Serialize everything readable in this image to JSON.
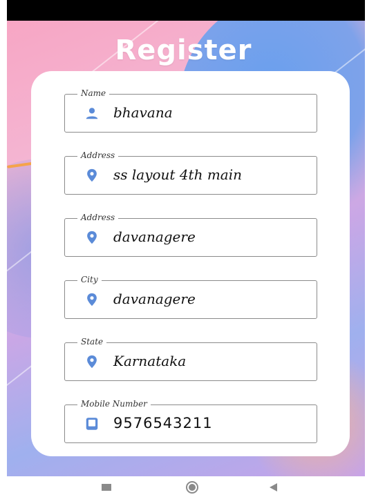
{
  "title": "Register",
  "colors": {
    "accent_icon": "#5b8bd8",
    "card": "#ffffff"
  },
  "fields": [
    {
      "label": "Name",
      "value": "bhavana",
      "icon": "person-icon"
    },
    {
      "label": "Address",
      "value": "ss layout 4th main",
      "icon": "location-pin-icon"
    },
    {
      "label": "Address",
      "value": "davanagere",
      "icon": "location-pin-icon"
    },
    {
      "label": "City",
      "value": "davanagere",
      "icon": "location-pin-icon"
    },
    {
      "label": "State",
      "value": "Karnataka",
      "icon": "location-pin-icon"
    },
    {
      "label": "Mobile Number",
      "value": "9576543211",
      "icon": "phone-icon"
    }
  ],
  "nav": {
    "recents": "recents-icon",
    "home": "home-icon",
    "back": "back-icon"
  }
}
